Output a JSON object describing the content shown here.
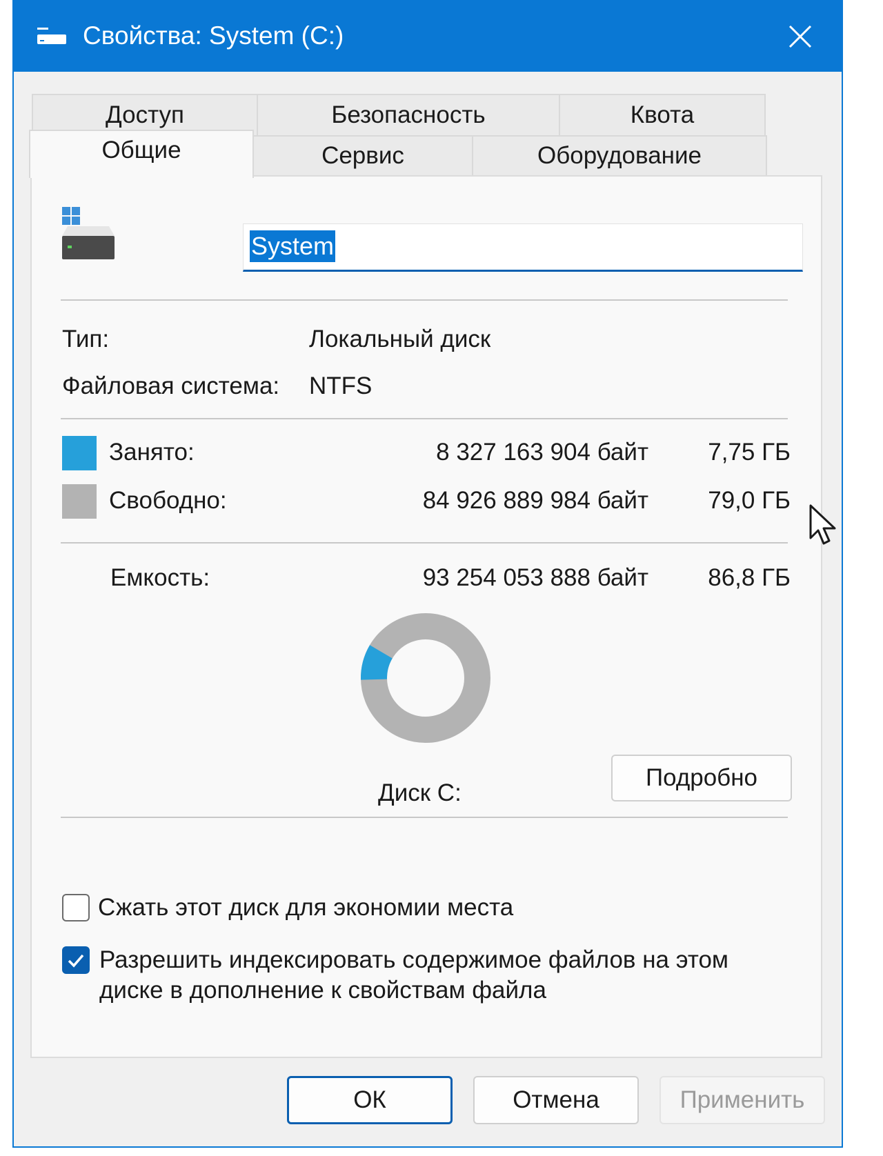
{
  "window": {
    "title": "Свойства: System (C:)"
  },
  "tabs": {
    "row_back": [
      "Доступ",
      "Безопасность",
      "Квота"
    ],
    "row_front": [
      "Общие",
      "Сервис",
      "Оборудование"
    ],
    "active": "Общие"
  },
  "general": {
    "volume_name": "System",
    "type_label": "Тип:",
    "type_value": "Локальный диск",
    "fs_label": "Файловая система:",
    "fs_value": "NTFS",
    "used_label": "Занято:",
    "used_bytes": "8 327 163 904 байт",
    "used_size": "7,75 ГБ",
    "free_label": "Свободно:",
    "free_bytes": "84 926 889 984 байт",
    "free_size": "79,0 ГБ",
    "capacity_label": "Емкость:",
    "capacity_bytes": "93 254 053 888 байт",
    "capacity_size": "86,8 ГБ",
    "disk_label": "Диск С:",
    "details_button": "Подробно",
    "compress_label": "Сжать этот диск для экономии места",
    "compress_checked": false,
    "index_label_line1": "Разрешить индексировать содержимое файлов на этом",
    "index_label_line2": "диске в дополнение к свойствам файла",
    "index_checked": true
  },
  "usage": {
    "used_bytes": 8327163904,
    "free_bytes": 84926889984,
    "used_color": "#26a0da",
    "free_color": "#b3b3b3"
  },
  "buttons": {
    "ok": "ОК",
    "cancel": "Отмена",
    "apply": "Применить"
  },
  "colors": {
    "accent": "#0a78d4"
  }
}
